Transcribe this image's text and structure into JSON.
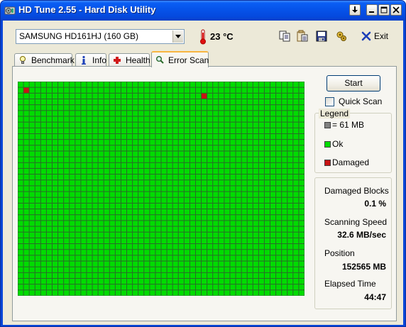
{
  "window": {
    "title": "HD Tune 2.55 - Hard Disk Utility"
  },
  "toolbar": {
    "drive": "SAMSUNG HD161HJ (160 GB)",
    "temperature": "23 °C",
    "exit_label": "Exit",
    "icons": [
      "thermometer-icon",
      "copy-icon",
      "copy-info-icon",
      "save-icon",
      "options-icon",
      "exit-icon"
    ]
  },
  "tabs": [
    {
      "label": "Benchmark",
      "icon": "benchmark-icon"
    },
    {
      "label": "Info",
      "icon": "info-icon"
    },
    {
      "label": "Health",
      "icon": "health-icon"
    },
    {
      "label": "Error Scan",
      "icon": "search-icon",
      "active": true
    }
  ],
  "scan": {
    "columns": 50,
    "rows": 37,
    "damaged_cells": [
      [
        1,
        1
      ],
      [
        32,
        2
      ]
    ],
    "ok_color": "#00dc00",
    "damaged_color": "#c81414",
    "grid_color": "#2a6b2a"
  },
  "controls": {
    "start_label": "Start",
    "quick_scan_label": "Quick Scan",
    "quick_scan_checked": false
  },
  "legend": {
    "title": "Legend",
    "block_label": "= 61 MB",
    "ok_label": "Ok",
    "damaged_label": "Damaged"
  },
  "stats": {
    "damaged_blocks_label": "Damaged Blocks",
    "damaged_blocks_value": "0.1 %",
    "scan_speed_label": "Scanning Speed",
    "scan_speed_value": "32.6 MB/sec",
    "position_label": "Position",
    "position_value": "152565 MB",
    "elapsed_label": "Elapsed Time",
    "elapsed_value": "44:47"
  }
}
